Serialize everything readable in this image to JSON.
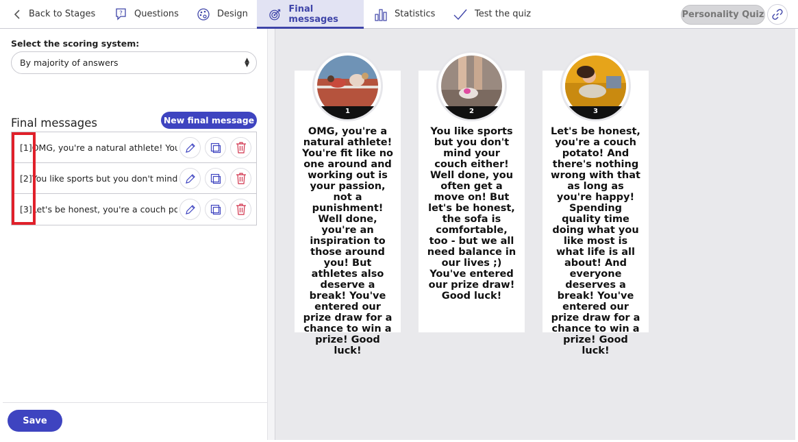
{
  "nav": {
    "back": "Back to Stages",
    "questions": "Questions",
    "design": "Design",
    "final_messages": "Final messages",
    "statistics": "Statistics",
    "test": "Test the quiz",
    "quiz_type": "Personality Quiz"
  },
  "scoring": {
    "label": "Select the scoring system:",
    "value": "By majority of answers"
  },
  "final_messages": {
    "title": "Final messages",
    "new_button": "New final message",
    "items": [
      {
        "index": "[1]",
        "text": "OMG, you're a natural athlete! You're fit like no one around"
      },
      {
        "index": "[2]",
        "text": "You like sports but you don't mind your couch either!"
      },
      {
        "index": "[3]",
        "text": "Let's be honest, you're a couch potato!"
      }
    ]
  },
  "save": "Save",
  "cards": [
    {
      "number": "1",
      "text": "OMG, you're a natural athlete! You're fit like no one around and working out is your passion, not a punishment! Well done, you're an inspiration to those around you! But athletes also deserve a break! You've entered our prize draw for a chance to win a prize! Good luck!"
    },
    {
      "number": "2",
      "text": "You like sports but you don't mind your couch either! Well done, you often get a move on! But let's be honest, the sofa is comfortable, too - but we all need balance in our lives ;) You've entered our prize draw! Good luck!"
    },
    {
      "number": "3",
      "text": "Let's be honest, you're a couch potato! And there's nothing wrong with that as long as you're happy! Spending quality time doing what you like most is what life is all about! And everyone deserves a break! You've entered our prize draw for a chance to win a prize! Good luck!"
    }
  ],
  "colors": {
    "accent": "#3e44c0",
    "highlight": "#e0202a",
    "delete": "#d0304a"
  }
}
